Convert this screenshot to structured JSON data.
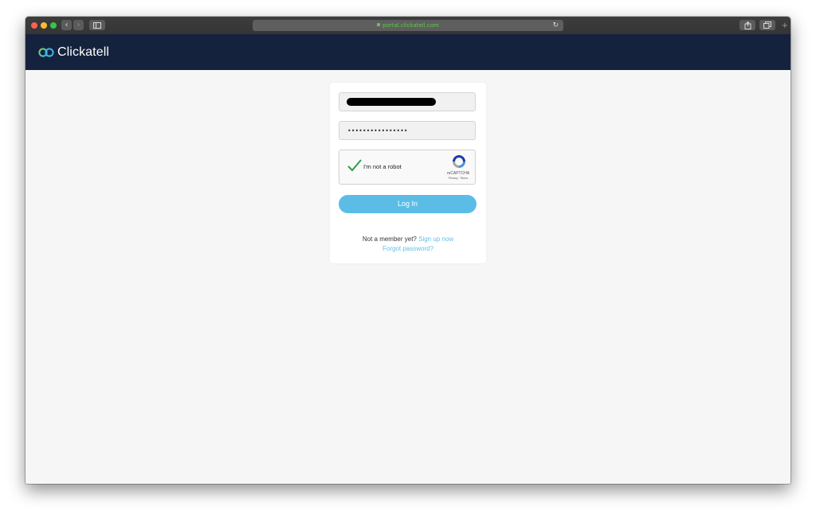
{
  "browser": {
    "url": "portal.clickatell.com",
    "colors": {
      "close": "#fc5f57",
      "minimize": "#fdbc2e",
      "zoom": "#33c748",
      "url_secure": "#5fc84a"
    },
    "icons": {
      "back": "chevron-left-icon",
      "forward": "chevron-right-icon",
      "sidebar": "sidebar-icon",
      "reload": "reload-icon",
      "share": "share-icon",
      "tabs": "tabs-icon",
      "new_tab": "plus-icon"
    }
  },
  "site": {
    "brand": "Clickatell",
    "header_color": "#15223d"
  },
  "login": {
    "email_value": "",
    "password_value": "••••••••••••••••",
    "captcha": {
      "label": "I'm not a robot",
      "brand": "reCAPTCHA",
      "links": "Privacy - Terms"
    },
    "submit_label": "Log In",
    "submit_color": "#5bbde6",
    "signup_prompt": "Not a member yet?",
    "signup_link": "Sign up now",
    "forgot_link": "Forgot password?",
    "link_color": "#64c0e8"
  }
}
